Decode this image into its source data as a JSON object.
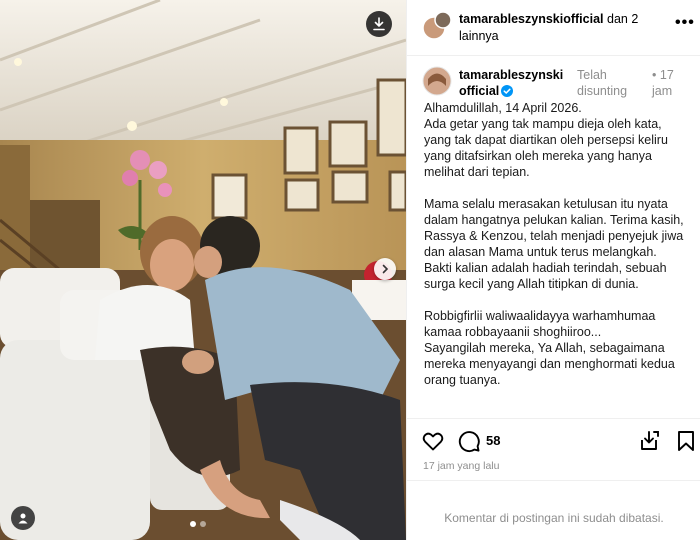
{
  "media": {
    "carousel": {
      "slides": 2,
      "active_index": 0
    },
    "icons": {
      "download": "download-icon",
      "next": "chevron-right-icon",
      "tagged_user": "user-icon"
    }
  },
  "header": {
    "username": "tamarableszynskiofficial",
    "suffix": " dan 2 lainnya",
    "more_label": "•••"
  },
  "caption": {
    "username": "tamarableszynski official",
    "edited_label": "Telah disunting",
    "separator": "•",
    "time": "17 jam",
    "body": "Alhamdulillah, 14 April 2026.\nAda getar yang tak mampu dieja oleh kata, yang tak dapat diartikan oleh persepsi keliru yang ditafsirkan oleh mereka yang hanya melihat dari tepian.\n\nMama selalu merasakan ketulusan itu nyata dalam hangatnya pelukan kalian. Terima kasih, Rassya & Kenzou, telah menjadi penyejuk jiwa dan alasan Mama untuk terus melangkah. Bakti kalian adalah hadiah terindah, sebuah surga kecil yang Allah titipkan di dunia.\n\nRobbigfirlii waliwaalidayya warhamhumaa kamaa robbayaanii shoghiiroo...\nSayangilah mereka, Ya Allah, sebagaimana mereka menyayangi dan menghormati kedua orang tuanya."
  },
  "actions": {
    "comment_count": "58",
    "timestamp": "17 jam yang lalu",
    "icons": [
      "heart-icon",
      "comment-icon",
      "share-icon",
      "bookmark-icon"
    ]
  },
  "footer": {
    "comments_disabled": "Komentar di postingan ini sudah dibatasi."
  },
  "colors": {
    "accent": "#0095f6",
    "muted": "#8e8e8e",
    "border": "#efefef"
  }
}
